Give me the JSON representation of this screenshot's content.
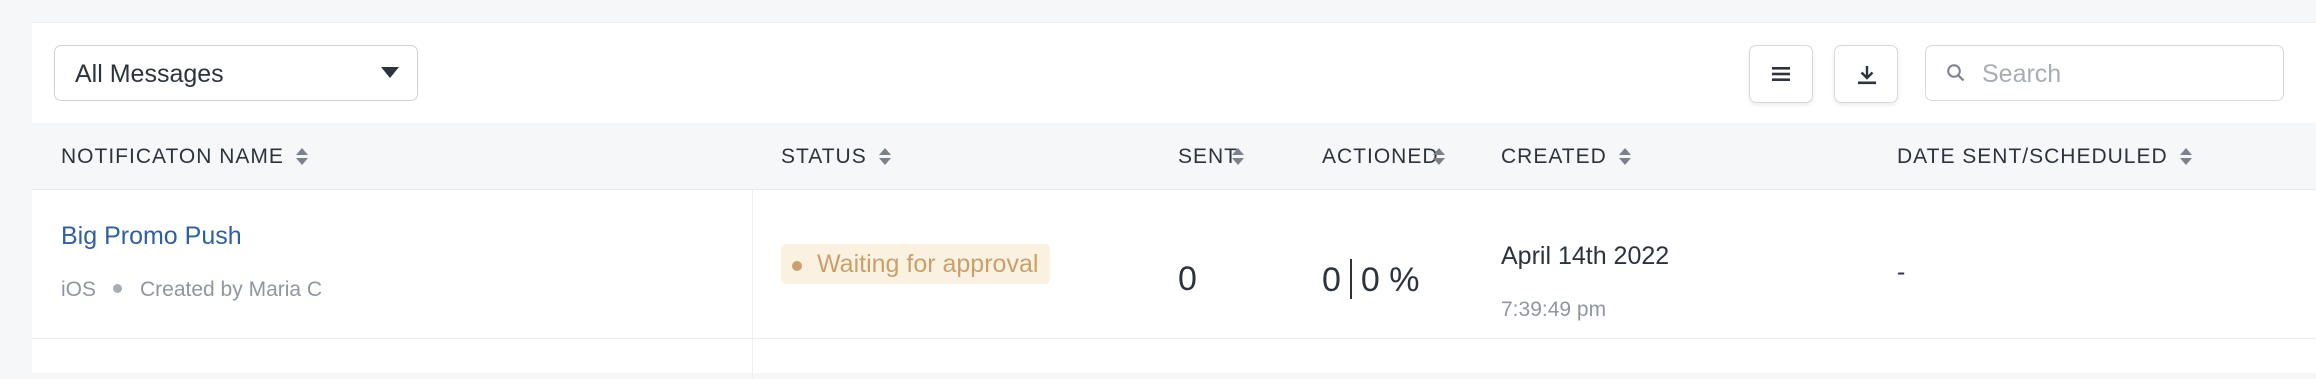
{
  "toolbar": {
    "filter_value": "All Messages",
    "search_placeholder": "Search"
  },
  "columns": [
    {
      "label": "NOTIFICATON NAME"
    },
    {
      "label": "STATUS"
    },
    {
      "label": "SENT"
    },
    {
      "label": "ACTIONED"
    },
    {
      "label": "CREATED"
    },
    {
      "label": "DATE SENT/SCHEDULED"
    }
  ],
  "rows": [
    {
      "name": "Big Promo Push",
      "platform": "iOS",
      "created_by": "Created by Maria C",
      "status": "Waiting for approval",
      "sent": "0",
      "actioned_count": "0",
      "actioned_percent": "0 %",
      "created_date": "April 14th 2022",
      "created_time": "7:39:49 pm",
      "date_sent": "-"
    }
  ],
  "colors": {
    "link": "#2f5fa0",
    "status_waiting_text": "#c9a06c",
    "status_waiting_bg": "#fbf1e1"
  },
  "icons": {
    "filter_caret": "caret-down-icon",
    "list_button": "list-icon",
    "download_button": "download-icon",
    "search": "search-icon",
    "sort": "sort-icon"
  }
}
